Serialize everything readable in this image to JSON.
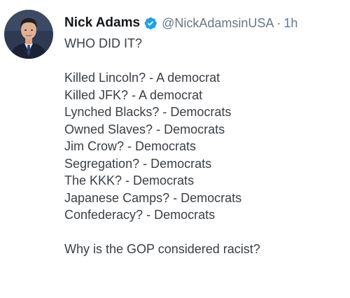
{
  "tweet": {
    "author": {
      "name": "Nick Adams",
      "handle": "@NickAdamsinUSA",
      "verified": true
    },
    "separator": "·",
    "time": "1h",
    "text": {
      "opening": "WHO DID IT?",
      "list": [
        "Killed Lincoln? - A democrat",
        "Killed JFK? - A democrat",
        "Lynched Blacks? - Democrats",
        "Owned Slaves? - Democrats",
        "Jim Crow? - Democrats",
        "Segregation? - Democrats",
        "The KKK? - Democrats",
        "Japanese Camps? - Democrats",
        "Confederacy? - Democrats"
      ],
      "closing": "Why is the GOP considered racist?"
    }
  },
  "colors": {
    "name": "#14171a",
    "secondary": "#657786",
    "body_text": "#3a3f44",
    "verified_badge": "#1da1f2",
    "background": "#ffffff"
  },
  "icons": {
    "verified": "verified-badge-icon",
    "avatar": "profile-photo"
  }
}
